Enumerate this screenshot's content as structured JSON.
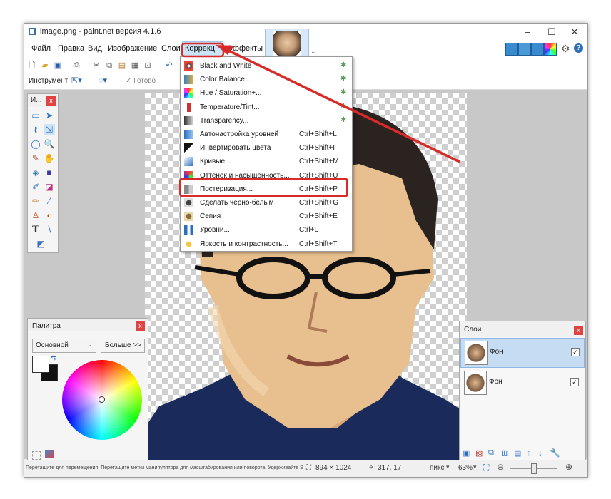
{
  "window": {
    "title": "image.png - paint.net версия 4.1.6",
    "minimize_icon": "minimize-icon",
    "maximize_icon": "maximize-icon",
    "close_icon": "close-icon"
  },
  "menu": {
    "items": [
      "Файл",
      "Правка",
      "Вид",
      "Изображение",
      "Слои",
      "Коррекц",
      "Эффекты"
    ]
  },
  "toolbar": {
    "instrument_label": "Инструмент:",
    "done_label": "Готово"
  },
  "tools_panel": {
    "title": "И...",
    "tools": [
      "rectangle-select-icon",
      "move-selection-icon",
      "lasso-icon",
      "move-selected-icon",
      "ellipse-select-icon",
      "zoom-icon",
      "magic-wand-icon",
      "pan-icon",
      "paint-bucket-icon",
      "gradient-icon",
      "brush-icon",
      "eraser-icon",
      "pencil-icon",
      "color-picker-icon",
      "clone-stamp-icon",
      "recolor-icon",
      "text-icon",
      "line-icon",
      "shapes-icon"
    ]
  },
  "palette_panel": {
    "title": "Палитра",
    "mode": "Основной",
    "more_button": "Больше >>",
    "swatches": [
      "#000000",
      "#404040",
      "#ff0000",
      "#ff6a00",
      "#ffd800",
      "#b6ff00",
      "#4cff00",
      "#00ff21",
      "#00ff90",
      "#00ffff",
      "#0094ff",
      "#0026ff",
      "#4800ff",
      "#b200ff",
      "#ff00dc",
      "#ff006e",
      "#ffffff",
      "#808080"
    ]
  },
  "layers_panel": {
    "title": "Слои",
    "layers": [
      {
        "name": "Фон",
        "visible": true,
        "selected": true
      },
      {
        "name": "Фон",
        "visible": true,
        "selected": false
      }
    ]
  },
  "correction_menu": {
    "items": [
      {
        "label": "Black and White",
        "shortcut": "",
        "plugin": true
      },
      {
        "label": "Color Balance...",
        "shortcut": "",
        "plugin": true
      },
      {
        "label": "Hue / Saturation+...",
        "shortcut": "",
        "plugin": true
      },
      {
        "label": "Temperature/Tint...",
        "shortcut": "",
        "plugin": true
      },
      {
        "label": "Transparency...",
        "shortcut": "",
        "plugin": true
      },
      {
        "label": "Автонастройка уровней",
        "shortcut": "Ctrl+Shift+L",
        "plugin": false
      },
      {
        "label": "Инвертировать цвета",
        "shortcut": "Ctrl+Shift+I",
        "plugin": false
      },
      {
        "label": "Кривые...",
        "shortcut": "Ctrl+Shift+M",
        "plugin": false
      },
      {
        "label": "Оттенок и насыщенность...",
        "shortcut": "Ctrl+Shift+U",
        "plugin": false
      },
      {
        "label": "Постеризация...",
        "shortcut": "Ctrl+Shift+P",
        "plugin": false
      },
      {
        "label": "Сделать черно-белым",
        "shortcut": "Ctrl+Shift+G",
        "plugin": false
      },
      {
        "label": "Сепия",
        "shortcut": "Ctrl+Shift+E",
        "plugin": false
      },
      {
        "label": "Уровни...",
        "shortcut": "Ctrl+L",
        "plugin": false
      },
      {
        "label": "Яркость и контрастность...",
        "shortcut": "Ctrl+Shift+T",
        "plugin": false
      }
    ]
  },
  "status_bar": {
    "hint": "Перетащите для перемещения. Перетащите метки манипулятора для масштабирования или поворота. Удерживайте Shift для ограничен...",
    "image_size": "894 × 1024",
    "cursor_pos": "317, 17",
    "units": "пикс",
    "zoom": "63%"
  },
  "colors": {
    "accent_red": "#d92a2a",
    "menu_highlight": "#cce4f7"
  }
}
